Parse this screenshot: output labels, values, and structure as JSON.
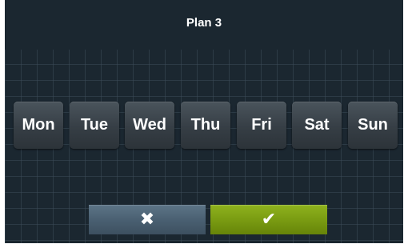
{
  "header": {
    "title": "Plan 3"
  },
  "days": [
    {
      "label": "Mon"
    },
    {
      "label": "Tue"
    },
    {
      "label": "Wed"
    },
    {
      "label": "Thu"
    },
    {
      "label": "Fri"
    },
    {
      "label": "Sat"
    },
    {
      "label": "Sun"
    }
  ],
  "footer": {
    "cancel": {
      "icon": "close-icon",
      "glyph": "✖",
      "color": "#4a6072"
    },
    "confirm": {
      "icon": "checkmark-icon",
      "glyph": "✔",
      "color": "#7a9c12"
    }
  },
  "colors": {
    "background": "#1b2730",
    "day_button": "#3a434a",
    "text": "#ffffff"
  }
}
